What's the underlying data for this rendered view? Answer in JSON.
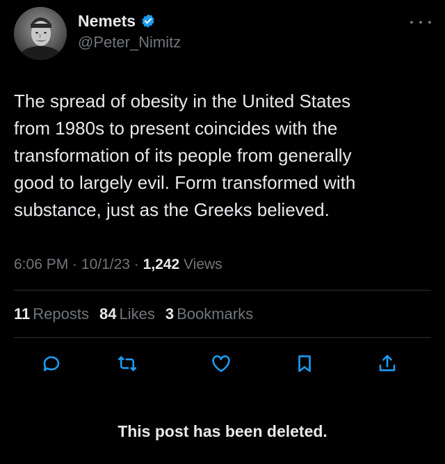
{
  "author": {
    "display_name": "Nemets",
    "handle": "@Peter_Nimitz",
    "verified": true,
    "verified_color": "#1d9bf0",
    "avatar": "grayscale portrait photo"
  },
  "more_menu": {
    "icon": "more-horizontal-icon"
  },
  "tweet": {
    "text": "The spread of obesity in the United States\nfrom 1980s to present coincides with the\ntransformation of its people from generally\ngood to largely evil. Form transformed with\nsubstance, just as the Greeks believed.",
    "time": "6:06 PM",
    "sep1": " · ",
    "date": "10/1/23",
    "sep2": " · ",
    "views_count": "1,242",
    "views_label": "Views"
  },
  "stats": {
    "reposts_count": "11",
    "reposts_label": "Reposts",
    "likes_count": "84",
    "likes_label": "Likes",
    "bookmarks_count": "3",
    "bookmarks_label": "Bookmarks"
  },
  "actions": [
    {
      "icon": "reply-icon"
    },
    {
      "icon": "repost-icon"
    },
    {
      "icon": "like-icon"
    },
    {
      "icon": "bookmark-icon"
    },
    {
      "icon": "share-icon"
    }
  ],
  "colors": {
    "background": "#000000",
    "primary_text": "#e7e9ea",
    "secondary_text": "#71767b",
    "divider": "#2f3336",
    "action_icon": "#1d9bf0"
  },
  "footer": {
    "deleted_notice": "This post has been deleted."
  }
}
